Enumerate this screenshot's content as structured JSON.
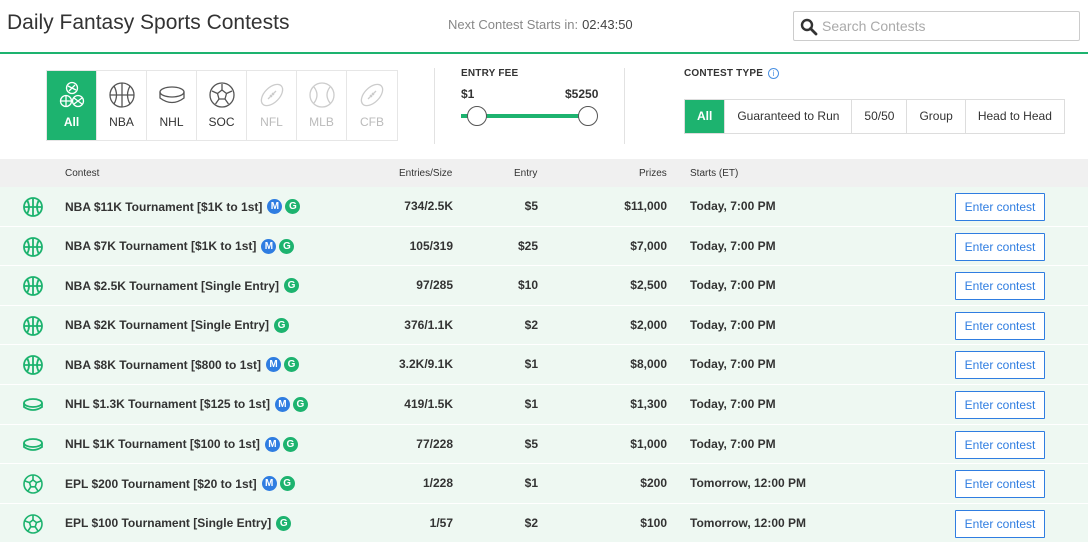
{
  "header": {
    "title": "Daily Fantasy Sports Contests",
    "countdown_label": "Next Contest Starts in:",
    "countdown_time": "02:43:50",
    "search_placeholder": "Search Contests"
  },
  "colors": {
    "accent": "#1db36f",
    "link": "#2f7de1",
    "row_bg": "#eef8f2"
  },
  "sports": [
    {
      "label": "All",
      "icon": "all-sports-icon",
      "state": "active"
    },
    {
      "label": "NBA",
      "icon": "basketball-icon",
      "state": "enabled"
    },
    {
      "label": "NHL",
      "icon": "hockey-puck-icon",
      "state": "enabled"
    },
    {
      "label": "SOC",
      "icon": "soccer-ball-icon",
      "state": "enabled"
    },
    {
      "label": "NFL",
      "icon": "football-icon",
      "state": "disabled"
    },
    {
      "label": "MLB",
      "icon": "baseball-icon",
      "state": "disabled"
    },
    {
      "label": "CFB",
      "icon": "football-icon",
      "state": "disabled"
    }
  ],
  "entry_fee": {
    "title": "ENTRY FEE",
    "min_label": "$1",
    "max_label": "$5250",
    "min": 1,
    "max": 5250
  },
  "contest_type": {
    "title": "CONTEST TYPE",
    "options": [
      "All",
      "Guaranteed to Run",
      "50/50",
      "Group",
      "Head to Head"
    ],
    "selected": "All"
  },
  "table": {
    "columns": {
      "contest": "Contest",
      "entries": "Entries/Size",
      "entry": "Entry",
      "prizes": "Prizes",
      "starts": "Starts (ET)"
    },
    "enter_label": "Enter contest",
    "rows": [
      {
        "sport": "basketball",
        "name": "NBA $11K Tournament [$1K to 1st]",
        "m": true,
        "g": true,
        "entries": "734/2.5K",
        "entry": "$5",
        "prizes": "$11,000",
        "starts": "Today, 7:00 PM"
      },
      {
        "sport": "basketball",
        "name": "NBA $7K Tournament [$1K to 1st]",
        "m": true,
        "g": true,
        "entries": "105/319",
        "entry": "$25",
        "prizes": "$7,000",
        "starts": "Today, 7:00 PM"
      },
      {
        "sport": "basketball",
        "name": "NBA $2.5K Tournament [Single Entry]",
        "m": false,
        "g": true,
        "entries": "97/285",
        "entry": "$10",
        "prizes": "$2,500",
        "starts": "Today, 7:00 PM"
      },
      {
        "sport": "basketball",
        "name": "NBA $2K Tournament [Single Entry]",
        "m": false,
        "g": true,
        "entries": "376/1.1K",
        "entry": "$2",
        "prizes": "$2,000",
        "starts": "Today, 7:00 PM"
      },
      {
        "sport": "basketball",
        "name": "NBA $8K Tournament [$800 to 1st]",
        "m": true,
        "g": true,
        "entries": "3.2K/9.1K",
        "entry": "$1",
        "prizes": "$8,000",
        "starts": "Today, 7:00 PM"
      },
      {
        "sport": "hockey",
        "name": "NHL $1.3K Tournament [$125 to 1st]",
        "m": true,
        "g": true,
        "entries": "419/1.5K",
        "entry": "$1",
        "prizes": "$1,300",
        "starts": "Today, 7:00 PM"
      },
      {
        "sport": "hockey",
        "name": "NHL $1K Tournament [$100 to 1st]",
        "m": true,
        "g": true,
        "entries": "77/228",
        "entry": "$5",
        "prizes": "$1,000",
        "starts": "Today, 7:00 PM"
      },
      {
        "sport": "soccer",
        "name": "EPL $200 Tournament [$20 to 1st]",
        "m": true,
        "g": true,
        "entries": "1/228",
        "entry": "$1",
        "prizes": "$200",
        "starts": "Tomorrow, 12:00 PM"
      },
      {
        "sport": "soccer",
        "name": "EPL $100 Tournament [Single Entry]",
        "m": false,
        "g": true,
        "entries": "1/57",
        "entry": "$2",
        "prizes": "$100",
        "starts": "Tomorrow, 12:00 PM"
      }
    ]
  }
}
